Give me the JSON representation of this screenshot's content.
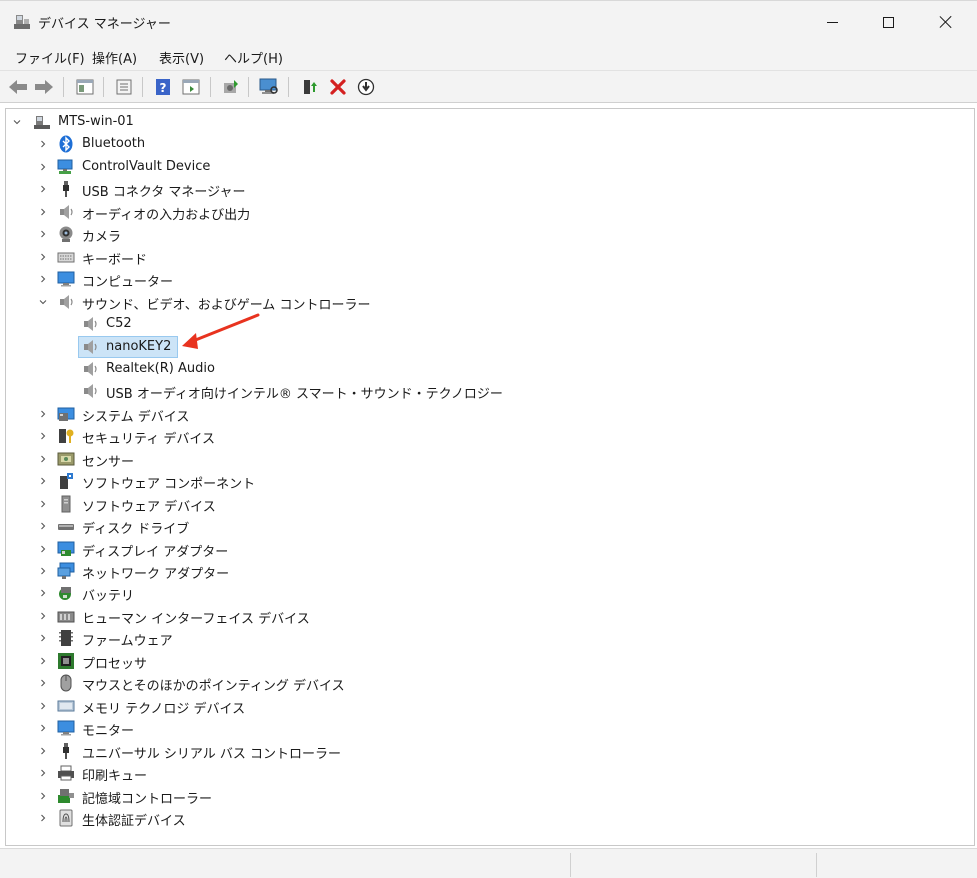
{
  "window": {
    "title": "デバイス マネージャー"
  },
  "menu": [
    "ファイル(F)",
    "操作(A)",
    "表示(V)",
    "ヘルプ(H)"
  ],
  "toolbar": {
    "buttons": [
      "back-arrow-icon",
      "forward-arrow-icon",
      "show-hide-tree-icon",
      "properties-icon",
      "help-icon",
      "action-pane-icon",
      "update-driver-icon",
      "scan-hardware-icon",
      "enable-device-icon",
      "uninstall-device-icon",
      "disable-device-icon"
    ]
  },
  "tree": {
    "root": "MTS-win-01",
    "categories": [
      "Bluetooth",
      "ControlVault Device",
      "USB コネクタ マネージャー",
      "オーディオの入力および出力",
      "カメラ",
      "キーボード",
      "コンピューター",
      "サウンド、ビデオ、およびゲーム コントローラー",
      "システム デバイス",
      "セキュリティ デバイス",
      "センサー",
      "ソフトウェア コンポーネント",
      "ソフトウェア デバイス",
      "ディスク ドライブ",
      "ディスプレイ アダプター",
      "ネットワーク アダプター",
      "バッテリ",
      "ヒューマン インターフェイス デバイス",
      "ファームウェア",
      "プロセッサ",
      "マウスとそのほかのポインティング デバイス",
      "メモリ テクノロジ デバイス",
      "モニター",
      "ユニバーサル シリアル バス コントローラー",
      "印刷キュー",
      "記憶域コントローラー",
      "生体認証デバイス"
    ],
    "expanded_index": 7,
    "sound_children": [
      "C52",
      "nanoKEY2",
      "Realtek(R) Audio",
      "USB オーディオ向けインテル® スマート・サウンド・テクノロジー"
    ],
    "selected_child_index": 1
  },
  "colors": {
    "selection_bg": "#cce4f7",
    "annotation_arrow": "#e8331f"
  }
}
